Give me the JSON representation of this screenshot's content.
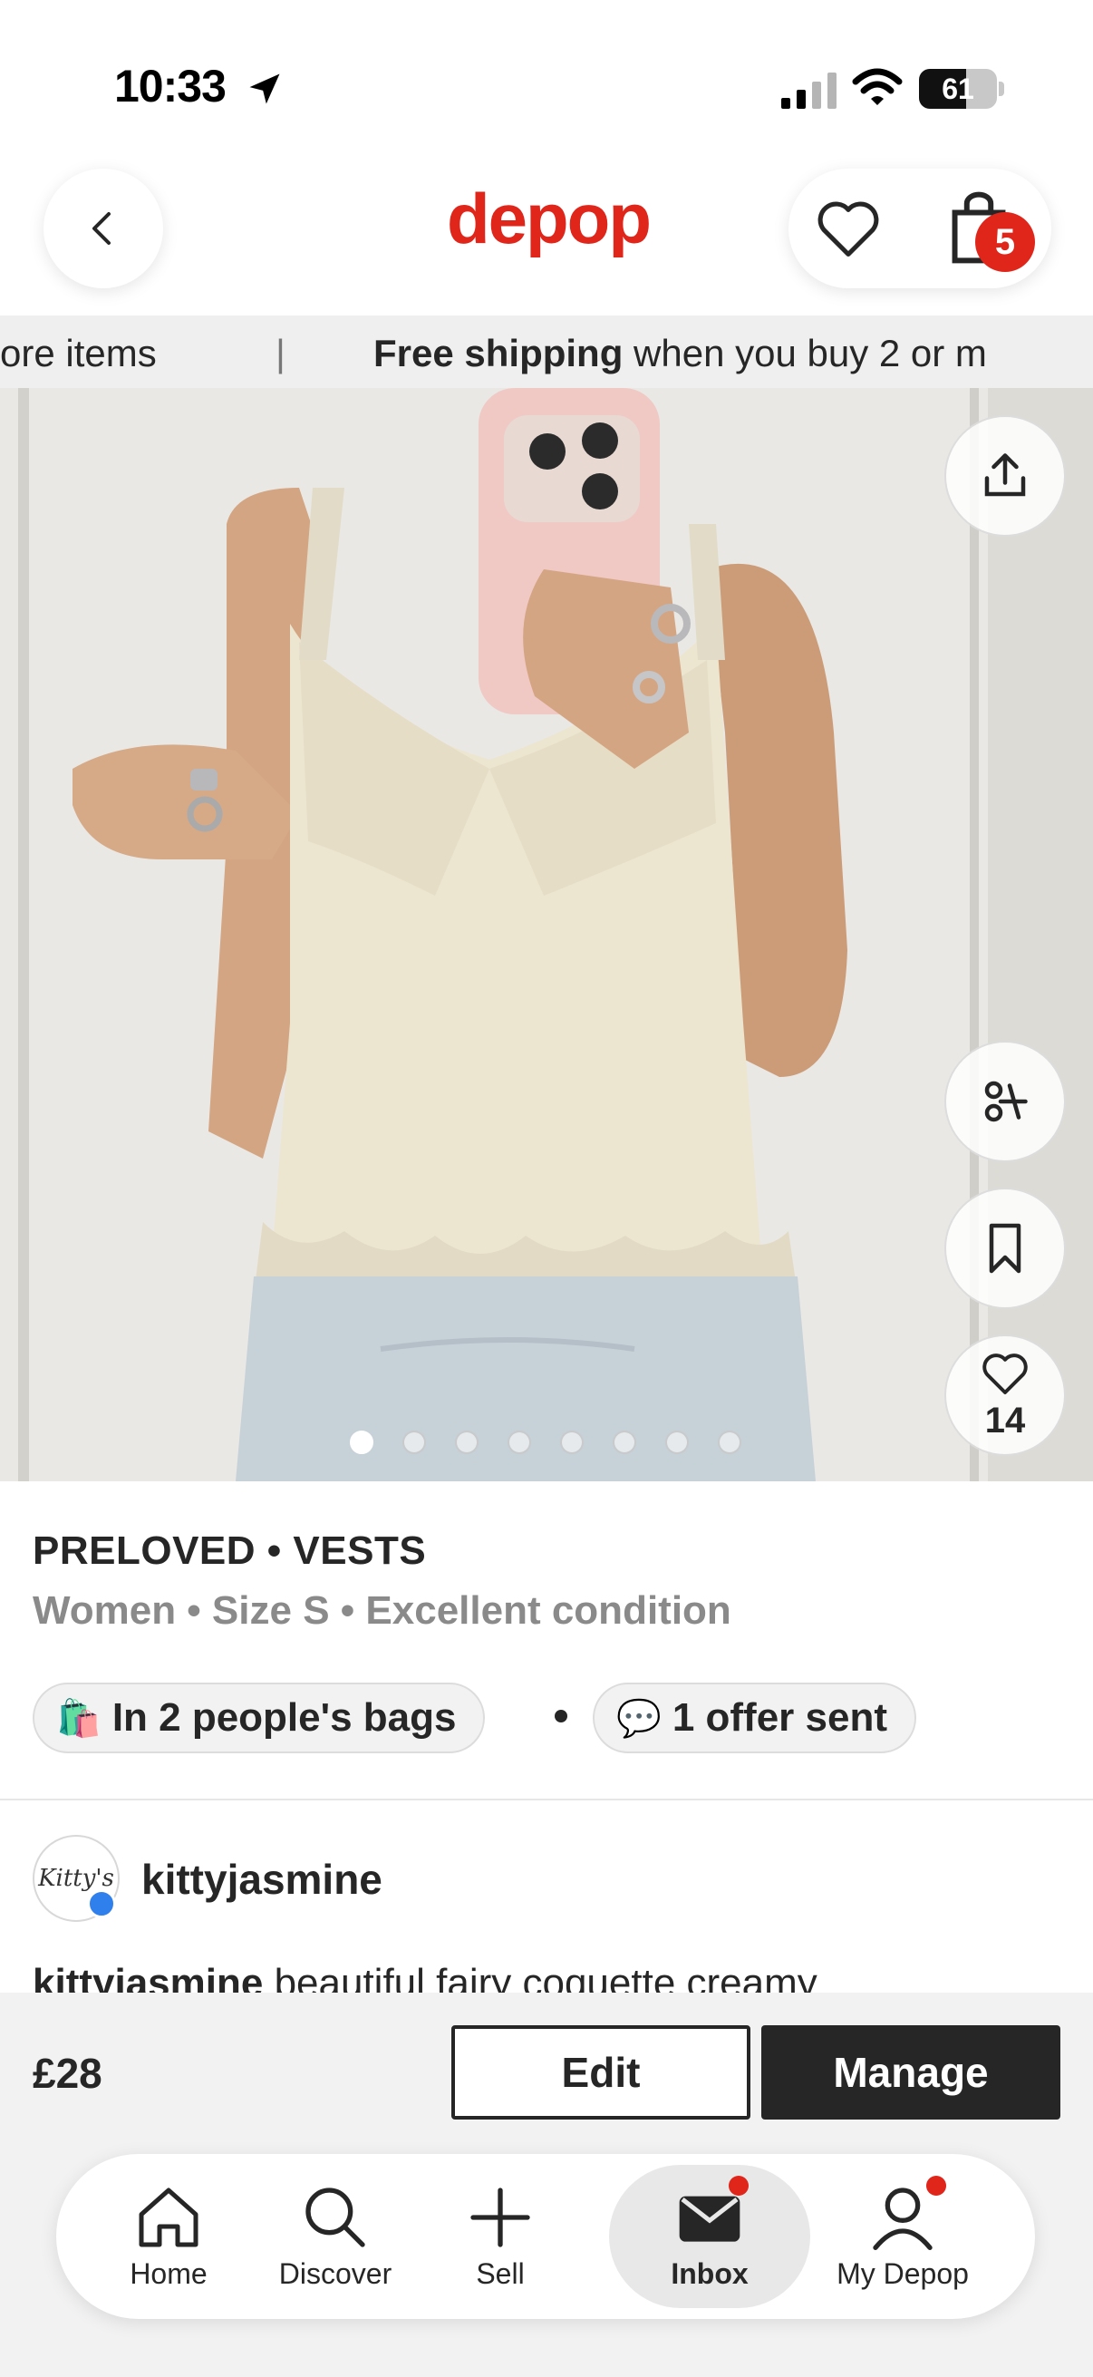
{
  "status_bar": {
    "time": "10:33",
    "battery": "61",
    "battery_level": 0.61
  },
  "header": {
    "logo": "depop",
    "cart_count": "5"
  },
  "promo": {
    "prev_tail": "ore items",
    "separator": "|",
    "bold": "Free shipping",
    "rest": " when you buy 2 or m"
  },
  "photo": {
    "likes_count": "14",
    "total_images": 8,
    "active_index": 0
  },
  "details": {
    "category": "PRELOVED • VESTS",
    "attributes": "Women • Size S • Excellent condition",
    "bags_pill": "In 2 people's bags",
    "bags_emoji": "🛍️",
    "offer_pill": "1 offer sent",
    "offer_emoji": "💬"
  },
  "seller": {
    "avatar_text": "Kitty's",
    "name": "kittyjasmine",
    "desc_user": "kittyjasmine",
    "desc_text": " beautiful fairy coquette creamy"
  },
  "action_bar": {
    "price": "£28",
    "edit_label": "Edit",
    "manage_label": "Manage"
  },
  "tabs": [
    {
      "label": "Home",
      "icon": "home-icon"
    },
    {
      "label": "Discover",
      "icon": "search-icon"
    },
    {
      "label": "Sell",
      "icon": "plus-icon"
    },
    {
      "label": "Inbox",
      "icon": "mail-icon",
      "active": true
    },
    {
      "label": "My Depop",
      "icon": "user-icon"
    }
  ],
  "colors": {
    "brand": "#e0261b",
    "dark": "#262626",
    "muted": "#8a8a8a"
  }
}
